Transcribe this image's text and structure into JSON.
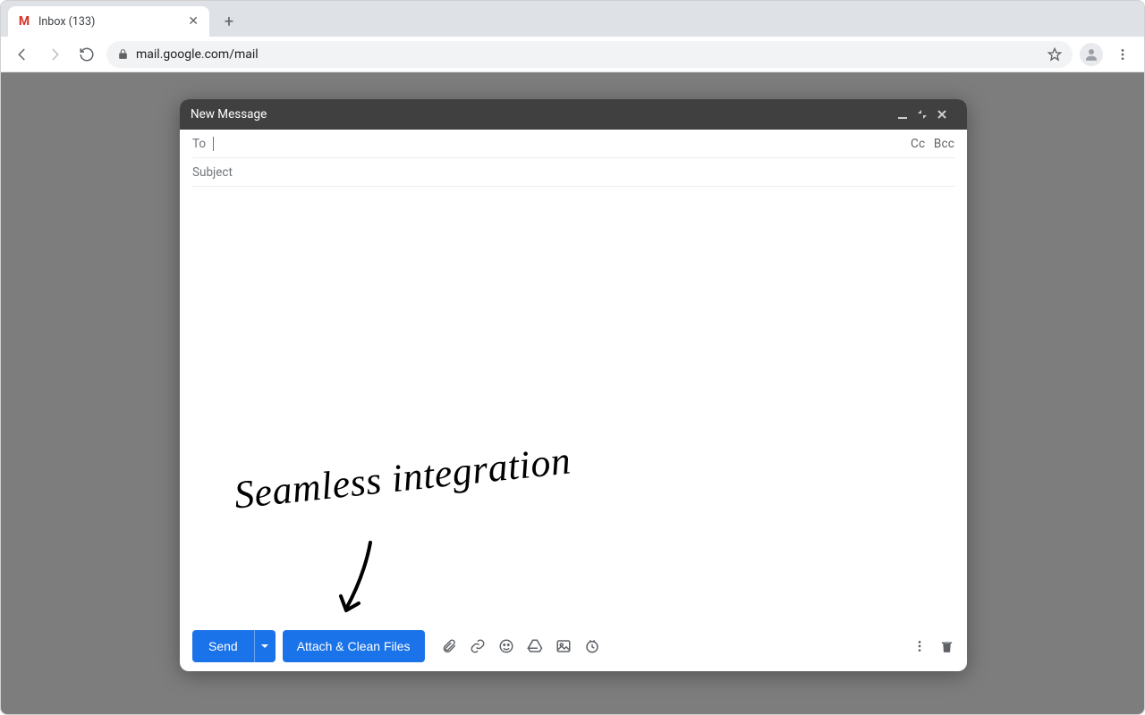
{
  "browser": {
    "tab_title": "Inbox (133)",
    "url": "mail.google.com/mail"
  },
  "compose": {
    "title": "New Message",
    "to_label": "To",
    "cc_label": "Cc",
    "bcc_label": "Bcc",
    "subject_placeholder": "Subject",
    "send_label": "Send",
    "attach_label": "Attach & Clean Files"
  },
  "annotation": {
    "text": "Seamless integration"
  }
}
